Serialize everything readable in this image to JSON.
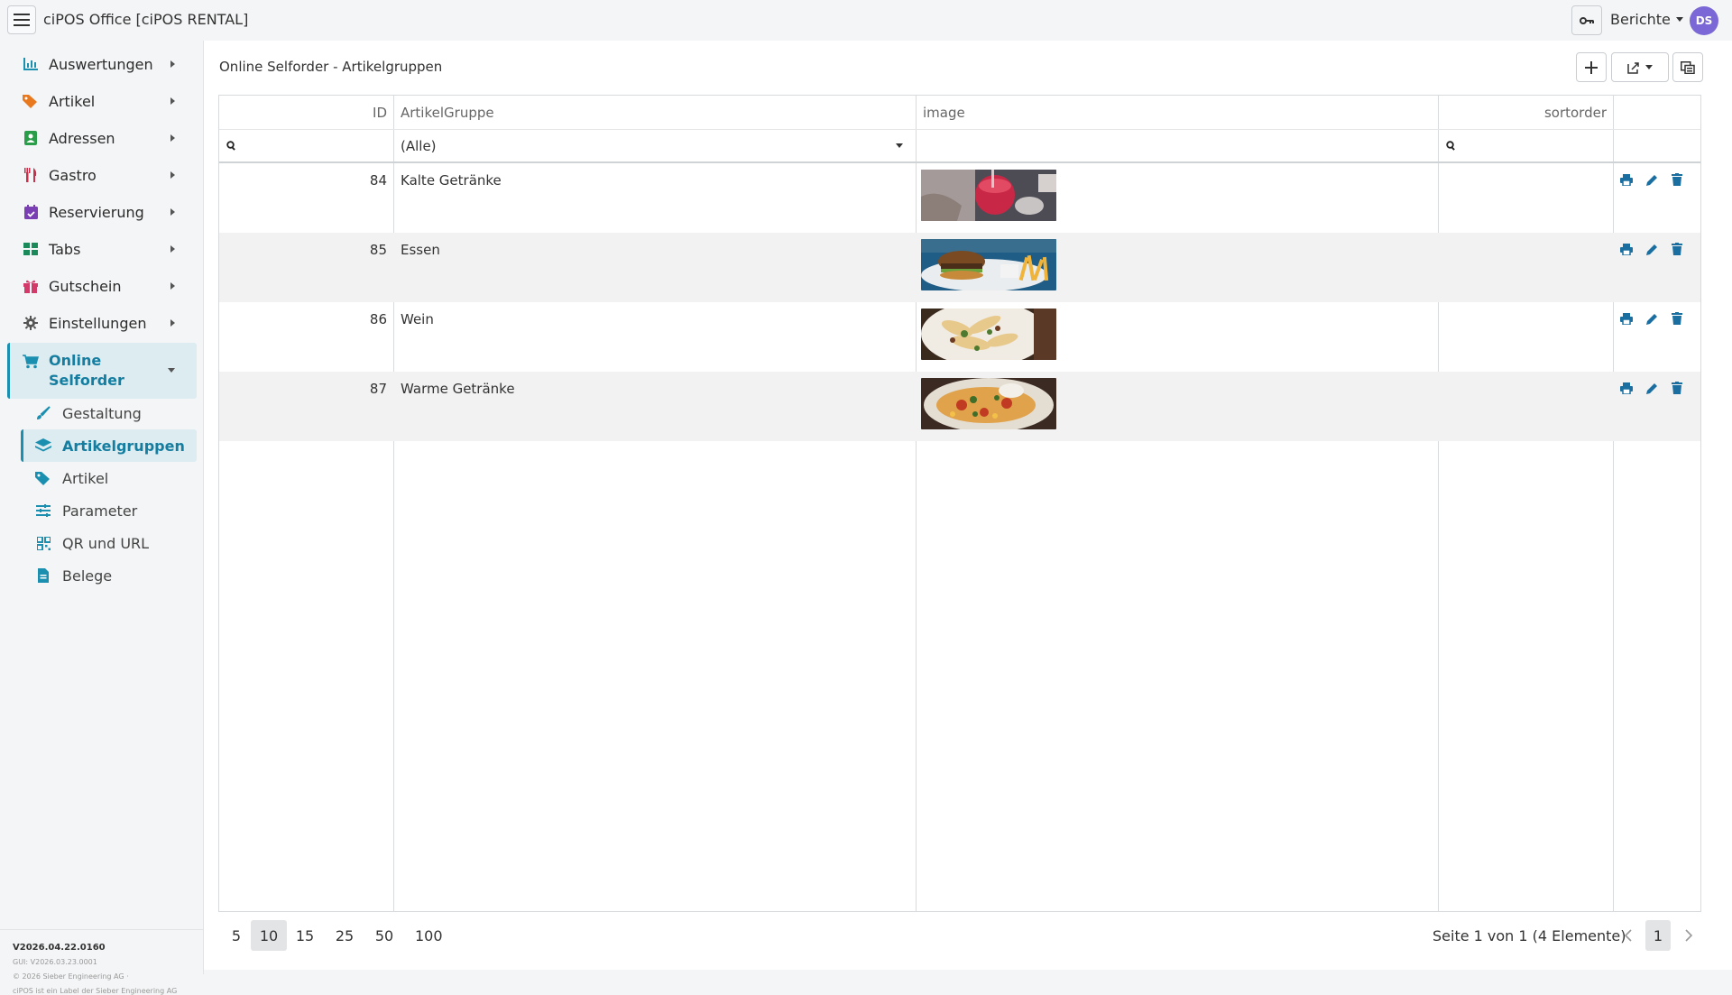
{
  "app": {
    "title": "ciPOS Office [ciPOS RENTAL]",
    "reports_label": "Berichte",
    "avatar_initials": "DS",
    "avatar_color": "#7b68d6"
  },
  "sidebar": {
    "items": [
      {
        "label": "Auswertungen",
        "icon": "chart-bar-icon",
        "color": "#1b8fb0"
      },
      {
        "label": "Artikel",
        "icon": "tags-icon",
        "color": "#e8791e"
      },
      {
        "label": "Adressen",
        "icon": "address-book-icon",
        "color": "#2a9d4b"
      },
      {
        "label": "Gastro",
        "icon": "utensils-icon",
        "color": "#c9304b"
      },
      {
        "label": "Reservierung",
        "icon": "calendar-check-icon",
        "color": "#7a3fb3"
      },
      {
        "label": "Tabs",
        "icon": "grid-icon",
        "color": "#1a8a5a"
      },
      {
        "label": "Gutschein",
        "icon": "gift-icon",
        "color": "#d23a6a"
      },
      {
        "label": "Einstellungen",
        "icon": "gear-icon",
        "color": "#555555"
      }
    ],
    "open_group": {
      "label": "Online Selforder",
      "icon": "cart-icon",
      "color": "#1b8fb0"
    },
    "sub_items": [
      {
        "label": "Gestaltung",
        "icon": "brush-icon"
      },
      {
        "label": "Artikelgruppen",
        "icon": "layers-icon"
      },
      {
        "label": "Artikel",
        "icon": "tags-icon"
      },
      {
        "label": "Parameter",
        "icon": "sliders-icon"
      },
      {
        "label": "QR und URL",
        "icon": "qrcode-icon"
      },
      {
        "label": "Belege",
        "icon": "file-icon"
      }
    ],
    "version": "V2026.04.22.0160",
    "gui_version": "GUI: V2026.03.23.0001",
    "copyright": "© 2026 Sieber Engineering AG ·",
    "label_note": "ciPOS ist ein Label der Sieber Engineering AG"
  },
  "main": {
    "title": "Online Selforder - Artikelgruppen",
    "columns": [
      "ID",
      "ArtikelGruppe",
      "image",
      "sortorder"
    ],
    "filter_select": "(Alle)",
    "rows": [
      {
        "id": "84",
        "group": "Kalte Getränke",
        "image": "drink-photo"
      },
      {
        "id": "85",
        "group": "Essen",
        "image": "burger-photo"
      },
      {
        "id": "86",
        "group": "Wein",
        "image": "pasta-photo"
      },
      {
        "id": "87",
        "group": "Warme Getränke",
        "image": "pizza-photo"
      }
    ],
    "page_sizes": [
      "5",
      "10",
      "15",
      "25",
      "50",
      "100"
    ],
    "selected_page_size": "10",
    "page_info": "Seite 1 von 1 (4 Elemente)",
    "current_page": "1"
  }
}
